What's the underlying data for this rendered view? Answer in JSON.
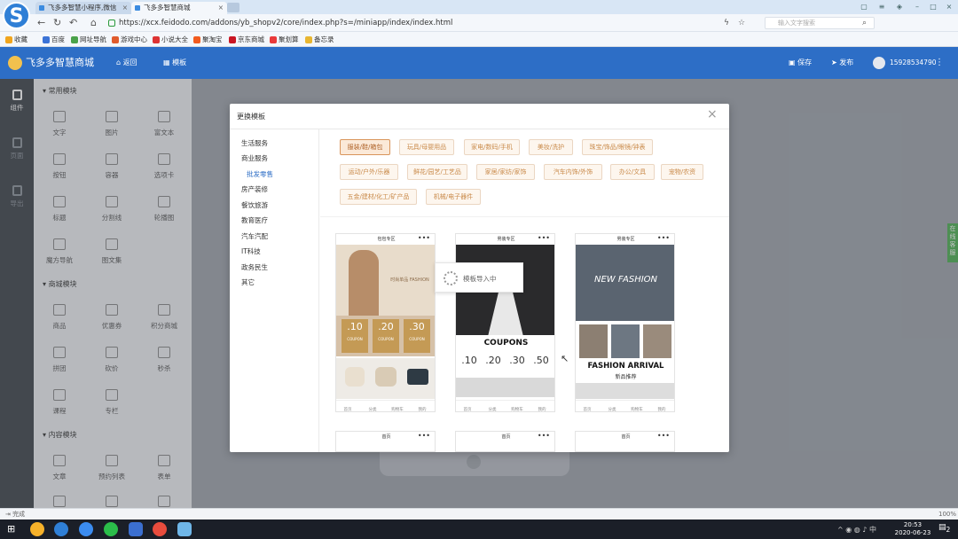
{
  "browser": {
    "logo_letter": "S",
    "tabs": [
      {
        "label": "飞多多智慧小程序,微信"
      },
      {
        "label": "飞多多智慧商城"
      }
    ],
    "url": "https://xcx.feidodo.com/addons/yb_shopv2/core/index.php?s=/miniapp/index/index.html",
    "search_placeholder": "输入文字搜索",
    "bookmarks": [
      {
        "label": "收藏",
        "color": "#f1a51d"
      },
      {
        "label": "百度",
        "color": "#3b73d6"
      },
      {
        "label": "网址导航",
        "color": "#4aa24a"
      },
      {
        "label": "游戏中心",
        "color": "#e05b2c"
      },
      {
        "label": "小说大全",
        "color": "#d33"
      },
      {
        "label": "聚淘宝",
        "color": "#f25b1f"
      },
      {
        "label": "京东商城",
        "color": "#c91623"
      },
      {
        "label": "聚划算",
        "color": "#e93a3a"
      },
      {
        "label": "备忘录",
        "color": "#e8b631"
      }
    ]
  },
  "app": {
    "name": "飞多多智慧商城",
    "back_label": "返回",
    "template_label": "模板",
    "save_label": "保存",
    "publish_label": "发布",
    "phone": "15928534790",
    "accent": "#2d6ec6"
  },
  "rail": [
    {
      "label": "组件"
    },
    {
      "label": "页面"
    },
    {
      "label": "导出"
    }
  ],
  "panel": {
    "sections": [
      {
        "title": "常用模块",
        "items": [
          "文字",
          "图片",
          "富文本",
          "按钮",
          "容器",
          "选项卡",
          "标题",
          "分割线",
          "轮播图",
          "魔方导航",
          "图文集"
        ]
      },
      {
        "title": "商城模块",
        "items": [
          "商品",
          "优惠券",
          "积分商城",
          "拼团",
          "砍价",
          "秒杀",
          "课程",
          "专栏"
        ]
      },
      {
        "title": "内容模块",
        "items": [
          "文章",
          "预约列表",
          "表单"
        ]
      }
    ]
  },
  "side_tab": "在线客服",
  "modal": {
    "title": "更换模板",
    "categories": [
      "生活服务",
      "商业服务",
      "批发零售",
      "房产装修",
      "餐饮旅游",
      "教育医疗",
      "汽车汽配",
      "IT科技",
      "政务民生",
      "其它"
    ],
    "tags": [
      "服装/鞋/箱包",
      "玩具/母婴用品",
      "家电/数码/手机",
      "美妆/洗护",
      "珠宝/饰品/眼镜/钟表",
      "运动/户外/乐器",
      "鲜花/园艺/工艺品",
      "家居/家纺/家饰",
      "汽车内饰/外饰",
      "办公/文具",
      "宠物/农资",
      "五金/建材/化工/矿产品",
      "机械/电子器件"
    ],
    "loading_text": "模板导入中",
    "cards": [
      {
        "title": "包包专区",
        "coupons": [
          ".10",
          ".20",
          ".30"
        ],
        "coupon_label": "COUPON",
        "model_text": "时尚单品 FASHION",
        "nav": [
          "首页",
          "分类",
          "购物车",
          "我的"
        ]
      },
      {
        "title": "男装专区",
        "banner": "COUPONS",
        "coupons": [
          ".10",
          ".20",
          ".30",
          ".50"
        ],
        "nav": [
          "首页",
          "分类",
          "购物车",
          "我的"
        ]
      },
      {
        "title": "男装专区",
        "hero": "NEW FASHION",
        "headline": "FASHION ARRIVAL",
        "sub": "新品推荐",
        "nav": [
          "首页",
          "分类",
          "购物车",
          "我的"
        ]
      },
      {
        "title": "首页"
      },
      {
        "title": "首页"
      },
      {
        "title": "首页"
      }
    ]
  },
  "status": {
    "left": "完成",
    "zoom": "100%"
  },
  "clock": {
    "time": "20:53",
    "date": "2020-06-23"
  },
  "taskbar_badge": "2"
}
